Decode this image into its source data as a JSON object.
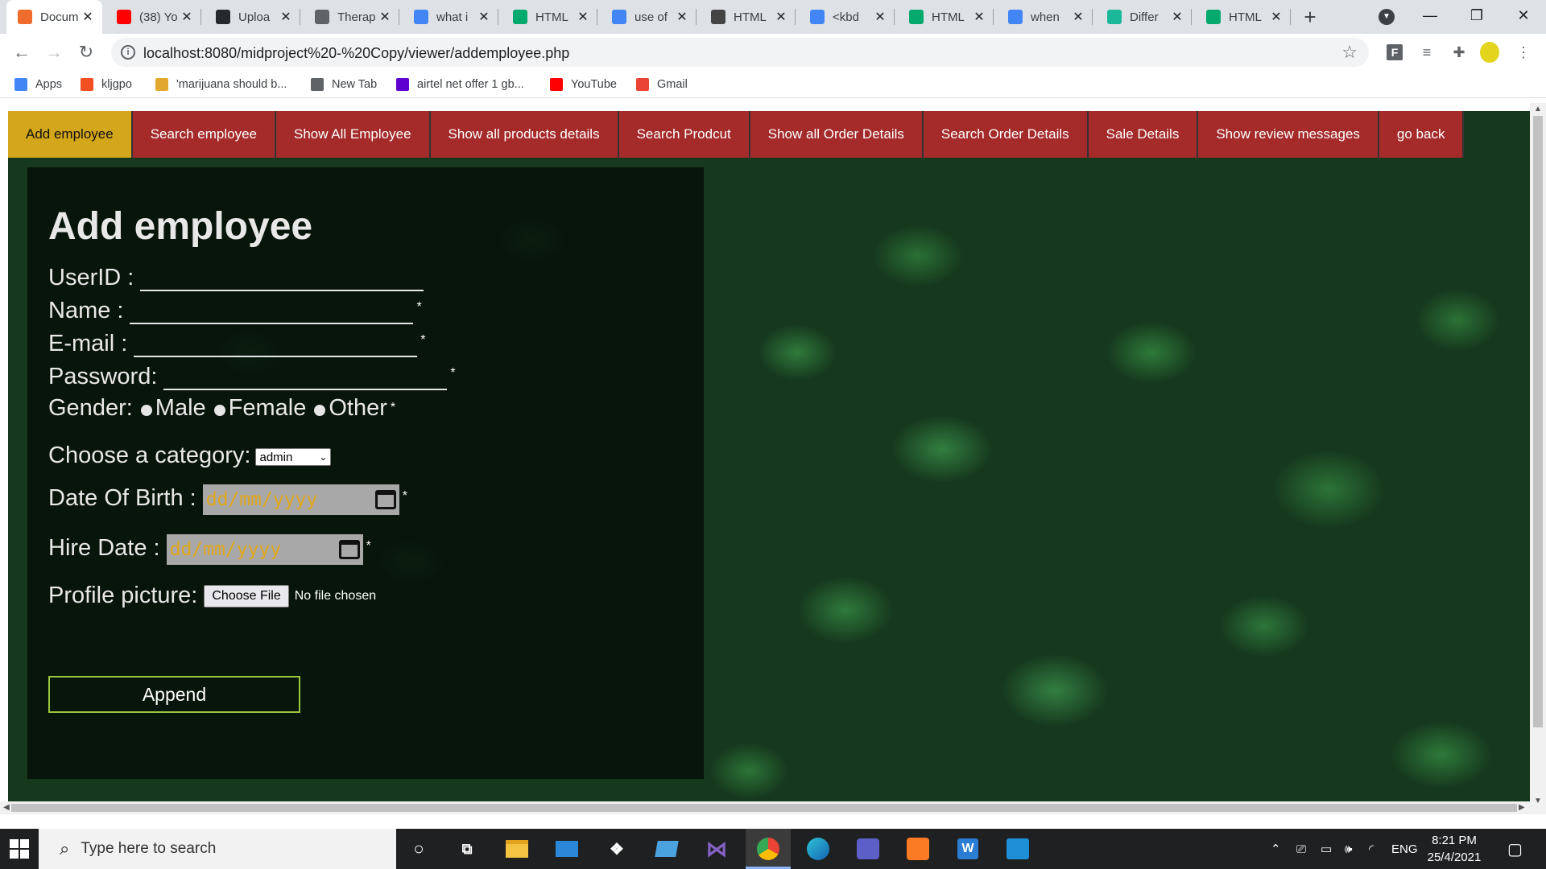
{
  "browser": {
    "tabs": [
      {
        "title": "Docum",
        "icon_name": "document-favicon",
        "icon_color": "#ef6c2c",
        "active": true
      },
      {
        "title": "(38) Yo",
        "icon_name": "youtube-favicon",
        "icon_color": "#ff0000",
        "active": false
      },
      {
        "title": "Uploa",
        "icon_name": "github-favicon",
        "icon_color": "#24292e",
        "active": false
      },
      {
        "title": "Therap",
        "icon_name": "globe-favicon",
        "icon_color": "#5f6368",
        "active": false
      },
      {
        "title": "what i",
        "icon_name": "google-favicon",
        "icon_color": "#4285f4",
        "active": false
      },
      {
        "title": "HTML",
        "icon_name": "w3schools-favicon",
        "icon_color": "#04aa6d",
        "active": false
      },
      {
        "title": "use of",
        "icon_name": "google-favicon",
        "icon_color": "#4285f4",
        "active": false
      },
      {
        "title": "HTML",
        "icon_name": "diamond-favicon",
        "icon_color": "#444444",
        "active": false
      },
      {
        "title": "<kbd",
        "icon_name": "google-favicon",
        "icon_color": "#4285f4",
        "active": false
      },
      {
        "title": "HTML",
        "icon_name": "w3schools-favicon",
        "icon_color": "#04aa6d",
        "active": false
      },
      {
        "title": "when",
        "icon_name": "google-favicon",
        "icon_color": "#4285f4",
        "active": false
      },
      {
        "title": "Differ",
        "icon_name": "shield-favicon",
        "icon_color": "#1bb99a",
        "active": false
      },
      {
        "title": "HTML",
        "icon_name": "w3schools-favicon",
        "icon_color": "#04aa6d",
        "active": false
      }
    ],
    "url": "localhost:8080/midproject%20-%20Copy/viewer/addemployee.php",
    "bookmarks": [
      {
        "label": "Apps",
        "icon_name": "apps-grid-icon",
        "icon_color": "#4285f4"
      },
      {
        "label": "kljgpo",
        "icon_name": "windows-colored-icon",
        "icon_color": "#f25022"
      },
      {
        "label": "'marijuana should b...",
        "icon_name": "cup-icon",
        "icon_color": "#e2a72e"
      },
      {
        "label": "New Tab",
        "icon_name": "globe-icon",
        "icon_color": "#5f6368"
      },
      {
        "label": "airtel net offer 1 gb...",
        "icon_name": "yahoo-icon",
        "icon_color": "#5f01d1"
      },
      {
        "label": "YouTube",
        "icon_name": "youtube-icon",
        "icon_color": "#ff0000"
      },
      {
        "label": "Gmail",
        "icon_name": "gmail-icon",
        "icon_color": "#ea4335"
      }
    ]
  },
  "nav": {
    "items": [
      {
        "label": "Add employee",
        "active": true
      },
      {
        "label": "Search employee",
        "active": false
      },
      {
        "label": "Show All Employee",
        "active": false
      },
      {
        "label": "Show all products details",
        "active": false
      },
      {
        "label": "Search Prodcut",
        "active": false
      },
      {
        "label": "Show all Order Details",
        "active": false
      },
      {
        "label": "Search Order Details",
        "active": false
      },
      {
        "label": "Sale Details",
        "active": false
      },
      {
        "label": "Show review messages",
        "active": false
      },
      {
        "label": "go back",
        "active": false
      }
    ],
    "active_color": "#d4a619",
    "item_color": "#a52a2a"
  },
  "form": {
    "title": "Add employee",
    "userid_label": "UserID :",
    "name_label": "Name :",
    "email_label": "E-mail :",
    "password_label": "Password:",
    "gender_label": "Gender:",
    "gender_options": [
      "Male",
      "Female",
      "Other"
    ],
    "category_label": "Choose a category:",
    "category_selected": "admin",
    "dob_label": "Date Of Birth :",
    "dob_placeholder": "dd/mm/yyyy",
    "hire_label": "Hire Date :",
    "hire_placeholder": "dd/mm/yyyy",
    "picture_label": "Profile picture:",
    "file_button": "Choose File",
    "file_status": "No file chosen",
    "required_mark": "*",
    "submit_label": "Append"
  },
  "taskbar": {
    "search_placeholder": "Type here to search",
    "language": "ENG",
    "time": "8:21 PM",
    "date": "25/4/2021"
  }
}
